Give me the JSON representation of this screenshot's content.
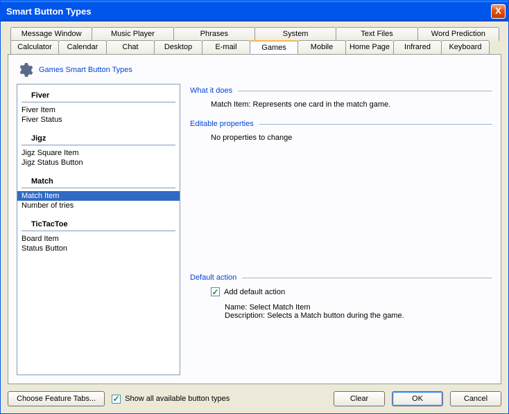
{
  "window": {
    "title": "Smart Button Types",
    "close": "X"
  },
  "tabs_row1": [
    "Message Window",
    "Music Player",
    "Phrases",
    "System",
    "Text Files",
    "Word Prediction"
  ],
  "tabs_row2": [
    "Calculator",
    "Calendar",
    "Chat",
    "Desktop",
    "E-mail",
    "Games",
    "Mobile",
    "Home Page",
    "Infrared",
    "Keyboard"
  ],
  "active_tab": "Games",
  "panel_title": "Games Smart Button Types",
  "groups": [
    {
      "name": "Fiver",
      "items": [
        "Fiver Item",
        "Fiver Status"
      ]
    },
    {
      "name": "Jigz",
      "items": [
        "Jigz Square Item",
        "Jigz Status Button"
      ]
    },
    {
      "name": "Match",
      "items": [
        "Match Item",
        "Number of tries"
      ]
    },
    {
      "name": "TicTacToe",
      "items": [
        "Board Item",
        "Status Button"
      ]
    }
  ],
  "selected_item": "Match Item",
  "sections": {
    "what_title": "What it does",
    "what_body": "Match Item: Represents one card in the match game.",
    "props_title": "Editable properties",
    "props_body": "No properties to change",
    "default_title": "Default action",
    "default_check_label": "Add default action",
    "default_checked": true,
    "default_name_label": "Name:",
    "default_name_value": "Select Match Item",
    "default_desc_label": "Description:",
    "default_desc_value": "Selects a Match button during the game."
  },
  "bottom": {
    "choose": "Choose Feature Tabs...",
    "show_all": "Show all available button types",
    "show_all_checked": true,
    "clear": "Clear",
    "ok": "OK",
    "cancel": "Cancel"
  }
}
